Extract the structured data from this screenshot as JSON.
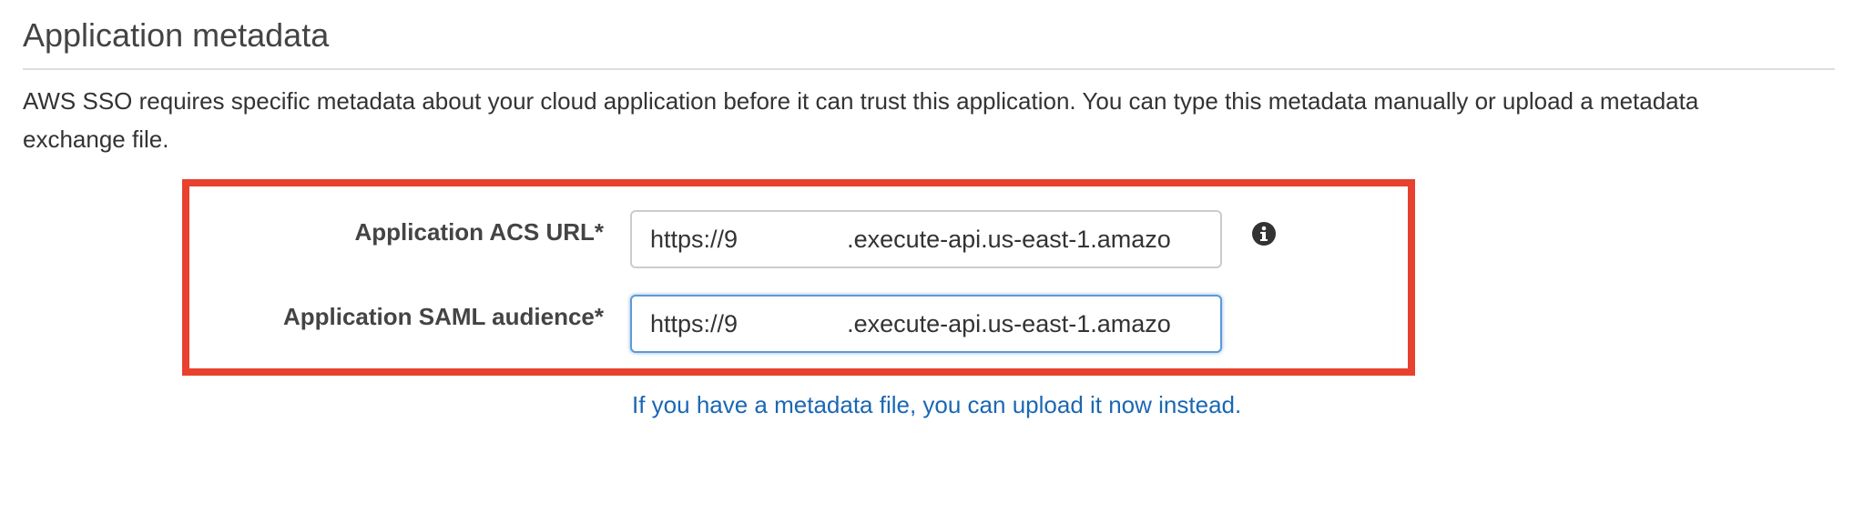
{
  "section": {
    "title": "Application metadata",
    "description": "AWS SSO requires specific metadata about your cloud application before it can trust this application. You can type this metadata manually or upload a metadata exchange file."
  },
  "form": {
    "acs_url": {
      "label": "Application ACS URL*",
      "value": "https://9                .execute-api.us-east-1.amazo"
    },
    "saml_audience": {
      "label": "Application SAML audience*",
      "value": "https://9                .execute-api.us-east-1.amazo"
    },
    "info_icon": "info-circle-icon"
  },
  "upload_link": {
    "text": "If you have a metadata file, you can upload it now instead."
  },
  "colors": {
    "highlight_border": "#e8412e",
    "link": "#1a67b3",
    "focus_border": "#5b9bd5"
  }
}
